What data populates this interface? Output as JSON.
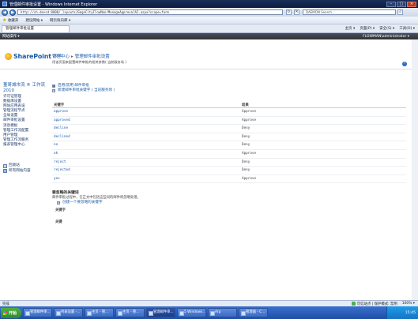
{
  "window": {
    "title": "管理邮件审批设置 - Windows Internet Explorer"
  },
  "addressbar": {
    "url": "http://sh-devsd:8000/_layouts/EmgeCityFlowMan/ManageApprovalAI.aspx?scope=farm",
    "search_placeholder": "DAEMON Search"
  },
  "favorites": {
    "label": "收藏夹",
    "items": [
      "建议网站 ▾",
      "网页快讯库 ▾"
    ]
  },
  "tabs": {
    "active": "管理邮件审批设置",
    "commands": [
      "主页 ▾",
      "页面(P) ▾",
      "安全(S) ▾",
      "工具(O) ▾"
    ]
  },
  "sp_topbar": {
    "site_actions": "网站操作 ▾",
    "user": "FLOWMAN\\administrator ▾"
  },
  "header": {
    "logo_text": "SharePoint",
    "logo_version": "2010",
    "crumb_root": "管理中心",
    "crumb_sep": "▸",
    "crumb_current": "管理邮件审批设置",
    "description": "用该页面来配置邮件审批的相关参数( 当前服务场 )",
    "help": "?"
  },
  "leftnav": {
    "heading": "董哥城市流 ® 工作流 2010",
    "items": [
      "许可证管理",
      "数据库设置",
      "网站应用表设",
      "管理流程节点",
      "全局设置",
      "邮件审批设置",
      "消息模板",
      "管理工作流配置",
      "用户管理",
      "管理工作流服务",
      "报表管理中心"
    ],
    "footer_items": [
      {
        "icon": "recycle-bin-icon",
        "label": "回收站"
      },
      {
        "icon": "site-content-icon",
        "label": "所有网站内容"
      }
    ]
  },
  "content": {
    "actions": [
      "启用/禁用 邮件审批",
      "新建邮件审批关键字 ( 当前服务场 )"
    ],
    "table": {
      "headers": [
        "关键字",
        "结果"
      ],
      "rows": [
        [
          "approve",
          "Approve"
        ],
        [
          "approved",
          "Approve"
        ],
        [
          "decline",
          "Deny"
        ],
        [
          "declined",
          "Deny"
        ],
        [
          "no",
          "Deny"
        ],
        [
          "ok",
          "Approve"
        ],
        [
          "reject",
          "Deny"
        ],
        [
          "rejected",
          "Deny"
        ],
        [
          "yes",
          "Approve"
        ]
      ]
    },
    "ignore_section": {
      "title": "要忽略的关键词",
      "description": "邮件审批过程中，在正文中包括这些词的邮件将忽略处理。",
      "action": "创建一个要忽略的关键字",
      "col_header": "关键字",
      "col_header2": "关键"
    }
  },
  "statusbar": {
    "left": "完成",
    "zone": "可信站点 | 保护模式: 禁用",
    "zoom": "100% ▾"
  },
  "taskbar": {
    "start": "开始",
    "buttons": [
      "管理邮件审...",
      "列表设置 -...",
      "主页 - 管...",
      "主页 - 管...",
      "管理邮件审...",
      "5 Windows...",
      "Arp",
      "管理器 - C..."
    ],
    "time": "15:45"
  }
}
